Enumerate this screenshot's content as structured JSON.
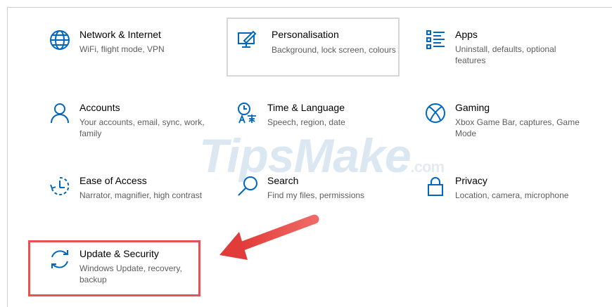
{
  "watermark": {
    "main": "TipsMake",
    "domain": ".com"
  },
  "tiles": [
    {
      "title": "Network & Internet",
      "desc": "WiFi, flight mode, VPN",
      "icon": "globe-icon"
    },
    {
      "title": "Personalisation",
      "desc": "Background, lock screen, colours",
      "icon": "paintbrush-screen-icon"
    },
    {
      "title": "Apps",
      "desc": "Uninstall, defaults, optional features",
      "icon": "apps-list-icon"
    },
    {
      "title": "Accounts",
      "desc": "Your accounts, email, sync, work, family",
      "icon": "person-icon"
    },
    {
      "title": "Time & Language",
      "desc": "Speech, region, date",
      "icon": "time-language-icon"
    },
    {
      "title": "Gaming",
      "desc": "Xbox Game Bar, captures, Game Mode",
      "icon": "xbox-icon"
    },
    {
      "title": "Ease of Access",
      "desc": "Narrator, magnifier, high contrast",
      "icon": "ease-of-access-icon"
    },
    {
      "title": "Search",
      "desc": "Find my files, permissions",
      "icon": "search-icon"
    },
    {
      "title": "Privacy",
      "desc": "Location, camera, microphone",
      "icon": "lock-icon"
    },
    {
      "title": "Update & Security",
      "desc": "Windows Update, recovery, backup",
      "icon": "sync-arrows-icon"
    }
  ],
  "colors": {
    "accent": "#0067c0",
    "annotation": "#e8514f",
    "hover_border": "#d7d7d7"
  }
}
